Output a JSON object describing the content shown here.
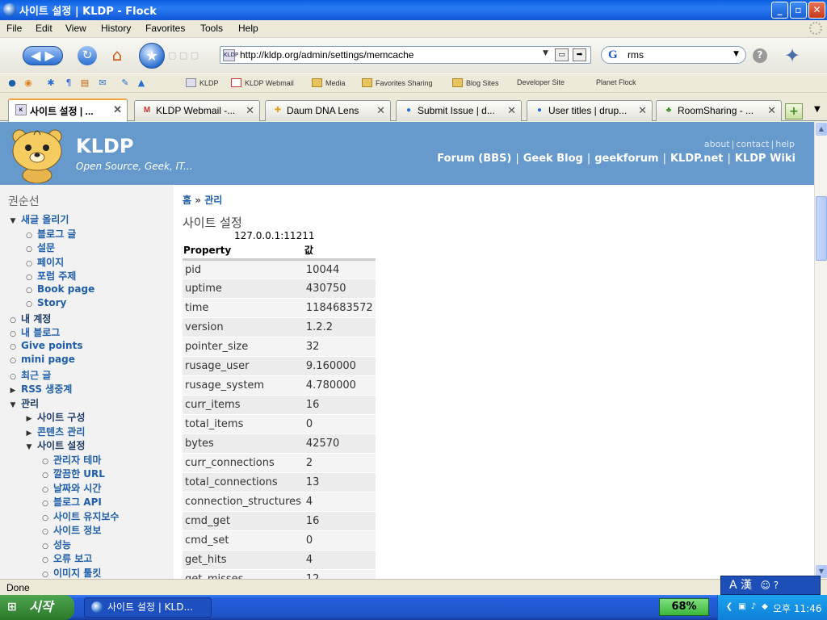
{
  "window": {
    "title": "사이트 설정 | KLDP - Flock",
    "controls": {
      "minimize": "_",
      "maximize": "▫",
      "close": "✕"
    }
  },
  "menubar": [
    "File",
    "Edit",
    "View",
    "History",
    "Favorites",
    "Tools",
    "Help"
  ],
  "navbar": {
    "url": "http://kldp.org/admin/settings/memcache",
    "search_engine": "G",
    "search_query": "rms"
  },
  "bookmarks": [
    {
      "label": "KLDP",
      "icon": "kldp"
    },
    {
      "label": "KLDP Webmail",
      "icon": "gmail"
    },
    {
      "label": "Media",
      "icon": "folder"
    },
    {
      "label": "Favorites Sharing",
      "icon": "folder"
    },
    {
      "label": "Blog Sites",
      "icon": "folder"
    },
    {
      "label": "Developer Site",
      "icon": "page"
    },
    {
      "label": "Planet Flock",
      "icon": "page"
    }
  ],
  "tabs": [
    {
      "label": "사이트 설정 | ...",
      "active": true
    },
    {
      "label": "KLDP Webmail -...",
      "active": false
    },
    {
      "label": "Daum DNA Lens",
      "active": false
    },
    {
      "label": "Submit Issue | d...",
      "active": false
    },
    {
      "label": "User titles | drup...",
      "active": false
    },
    {
      "label": "RoomSharing - ...",
      "active": false
    }
  ],
  "site": {
    "name": "KLDP",
    "slogan": "Open Source, Geek, IT...",
    "secondary_links": [
      "about",
      "contact",
      "help"
    ],
    "primary_links": [
      "Forum (BBS)",
      "Geek Blog",
      "geekforum",
      "KLDP.net",
      "KLDP Wiki"
    ]
  },
  "sidebar": {
    "user": "권순선",
    "items": [
      {
        "label": "새글 올리기",
        "bullet": "▼",
        "depth": 0
      },
      {
        "label": "블로그 글",
        "bullet": "○",
        "depth": 1
      },
      {
        "label": "설문",
        "bullet": "○",
        "depth": 1
      },
      {
        "label": "페이지",
        "bullet": "○",
        "depth": 1
      },
      {
        "label": "포럼 주제",
        "bullet": "○",
        "depth": 1
      },
      {
        "label": "Book page",
        "bullet": "○",
        "depth": 1
      },
      {
        "label": "Story",
        "bullet": "○",
        "depth": 1
      },
      {
        "label": "내 계정",
        "bullet": "○",
        "depth": 0,
        "dark": true
      },
      {
        "label": "내 블로그",
        "bullet": "○",
        "depth": 0
      },
      {
        "label": "Give points",
        "bullet": "○",
        "depth": 0
      },
      {
        "label": "mini page",
        "bullet": "○",
        "depth": 0
      },
      {
        "label": "최근 글",
        "bullet": "○",
        "depth": 0
      },
      {
        "label": "RSS 생중계",
        "bullet": "▶",
        "depth": 0
      },
      {
        "label": "관리",
        "bullet": "▼",
        "depth": 0,
        "dark": true
      },
      {
        "label": "사이트 구성",
        "bullet": "▶",
        "depth": 1,
        "dark": true
      },
      {
        "label": "콘텐츠 관리",
        "bullet": "▶",
        "depth": 1
      },
      {
        "label": "사이트 설정",
        "bullet": "▼",
        "depth": 1,
        "dark": true
      },
      {
        "label": "관리자 테마",
        "bullet": "○",
        "depth": 2
      },
      {
        "label": "깔끔한 URL",
        "bullet": "○",
        "depth": 2
      },
      {
        "label": "날짜와 시간",
        "bullet": "○",
        "depth": 2
      },
      {
        "label": "블로그 API",
        "bullet": "○",
        "depth": 2
      },
      {
        "label": "사이트 유지보수",
        "bullet": "○",
        "depth": 2
      },
      {
        "label": "사이트 정보",
        "bullet": "○",
        "depth": 2
      },
      {
        "label": "성능",
        "bullet": "○",
        "depth": 2
      },
      {
        "label": "오류 보고",
        "bullet": "○",
        "depth": 2
      },
      {
        "label": "이미지 툴킷",
        "bullet": "○",
        "depth": 2
      }
    ]
  },
  "content": {
    "breadcrumb": [
      "홈",
      "관리"
    ],
    "breadcrumb_sep": "»",
    "title": "사이트 설정",
    "server": "127.0.0.1:11211",
    "table": {
      "headers": [
        "Property",
        "값"
      ],
      "rows": [
        [
          "pid",
          "10044"
        ],
        [
          "uptime",
          "430750"
        ],
        [
          "time",
          "1184683572"
        ],
        [
          "version",
          "1.2.2"
        ],
        [
          "pointer_size",
          "32"
        ],
        [
          "rusage_user",
          "9.160000"
        ],
        [
          "rusage_system",
          "4.780000"
        ],
        [
          "curr_items",
          "16"
        ],
        [
          "total_items",
          "0"
        ],
        [
          "bytes",
          "42570"
        ],
        [
          "curr_connections",
          "2"
        ],
        [
          "total_connections",
          "13"
        ],
        [
          "connection_structures",
          "4"
        ],
        [
          "cmd_get",
          "16"
        ],
        [
          "cmd_set",
          "0"
        ],
        [
          "get_hits",
          "4"
        ],
        [
          "get_misses",
          "12"
        ]
      ]
    }
  },
  "statusbar": {
    "text": "Done",
    "ime": "A 漢"
  },
  "taskbar": {
    "start": "시작",
    "task": "사이트 설정 | KLD...",
    "battery": "68%",
    "clock": "오후 11:46"
  }
}
